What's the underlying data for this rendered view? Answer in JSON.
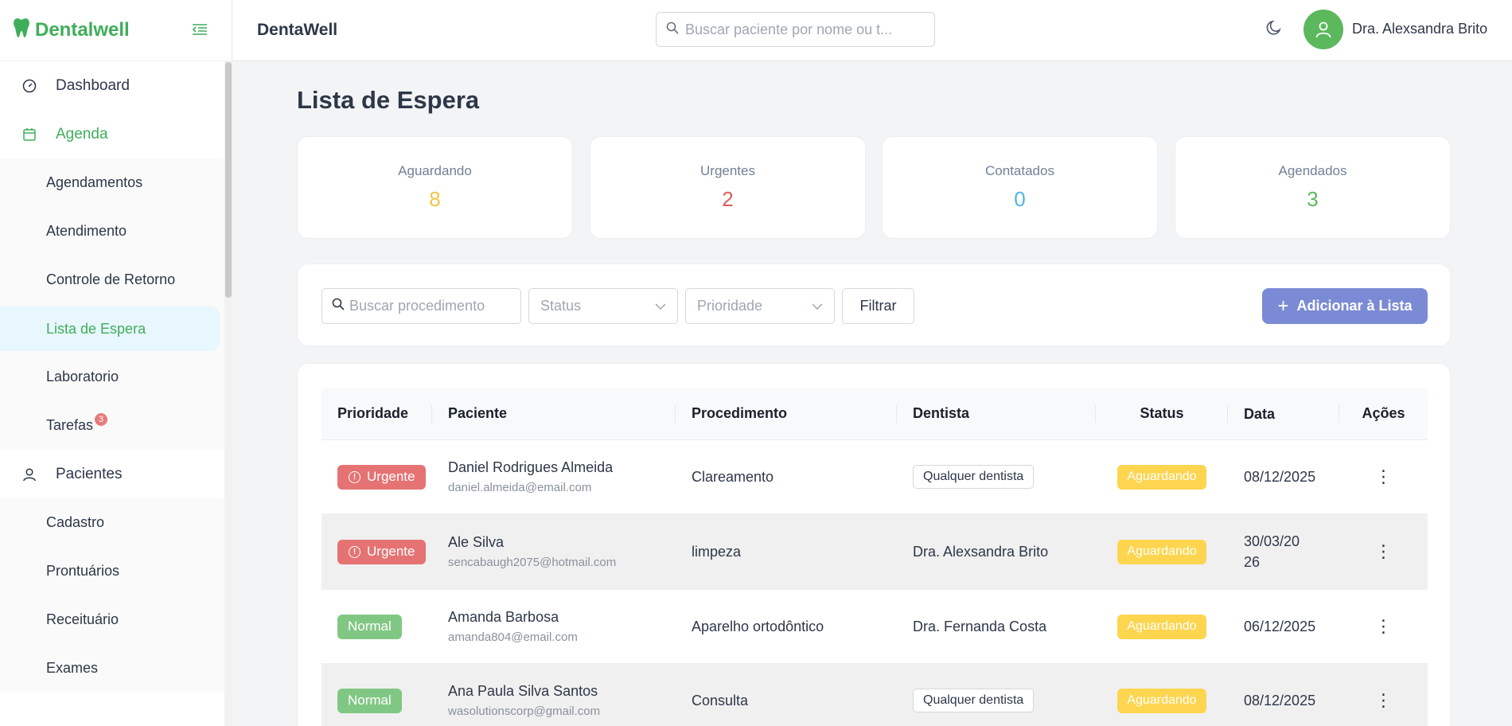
{
  "brand": {
    "name": "Dentalwell",
    "logo_icon": "tooth-icon"
  },
  "sidebar": {
    "items": [
      {
        "label": "Dashboard",
        "icon": "dashboard-icon"
      },
      {
        "label": "Agenda",
        "icon": "calendar-icon"
      },
      {
        "label": "Pacientes",
        "icon": "user-icon"
      }
    ],
    "agenda_sub": [
      "Agendamentos",
      "Atendimento",
      "Controle de Retorno",
      "Lista de Espera",
      "Laboratorio",
      "Tarefas"
    ],
    "tarefas_badge": "3",
    "pacientes_sub": [
      "Cadastro",
      "Prontuários",
      "Receituário",
      "Exames"
    ]
  },
  "header": {
    "title": "DentaWell",
    "search_placeholder": "Buscar paciente por nome ou t...",
    "user_name": "Dra. Alexsandra Brito"
  },
  "page": {
    "title": "Lista de Espera"
  },
  "stats": [
    {
      "label": "Aguardando",
      "value": "8",
      "color": "#f6c344"
    },
    {
      "label": "Urgentes",
      "value": "2",
      "color": "#e25c5c"
    },
    {
      "label": "Contatados",
      "value": "0",
      "color": "#4fb6e8"
    },
    {
      "label": "Agendados",
      "value": "3",
      "color": "#5cb85c"
    }
  ],
  "filters": {
    "search_placeholder": "Buscar procedimento",
    "status_placeholder": "Status",
    "priority_placeholder": "Prioridade",
    "filter_label": "Filtrar",
    "add_label": "Adicionar à Lista",
    "add_color": "#7b8ad4"
  },
  "table": {
    "headers": {
      "prio": "Prioridade",
      "pac": "Paciente",
      "proc": "Procedimento",
      "dent": "Dentista",
      "stat": "Status",
      "data": "Data",
      "act": "Ações"
    },
    "rows": [
      {
        "prio": "Urgente",
        "name": "Daniel Rodrigues Almeida",
        "email": "daniel.almeida@email.com",
        "proc": "Clareamento",
        "dent": "Qualquer dentista",
        "status": "Aguardando",
        "date": "08/12/2025"
      },
      {
        "prio": "Urgente",
        "name": "Ale Silva",
        "email": "sencabaugh2075@hotmail.com",
        "proc": "limpeza",
        "dent": "Dra. Alexsandra Brito",
        "status": "Aguardando",
        "date": "30/03/2026"
      },
      {
        "prio": "Normal",
        "name": "Amanda Barbosa",
        "email": "amanda804@email.com",
        "proc": "Aparelho ortodôntico",
        "dent": "Dra. Fernanda Costa",
        "status": "Aguardando",
        "date": "06/12/2025"
      },
      {
        "prio": "Normal",
        "name": "Ana Paula Silva Santos",
        "email": "wasolutionscorp@gmail.com",
        "proc": "Consulta",
        "dent": "Qualquer dentista",
        "status": "Aguardando",
        "date": "08/12/2025"
      }
    ]
  }
}
